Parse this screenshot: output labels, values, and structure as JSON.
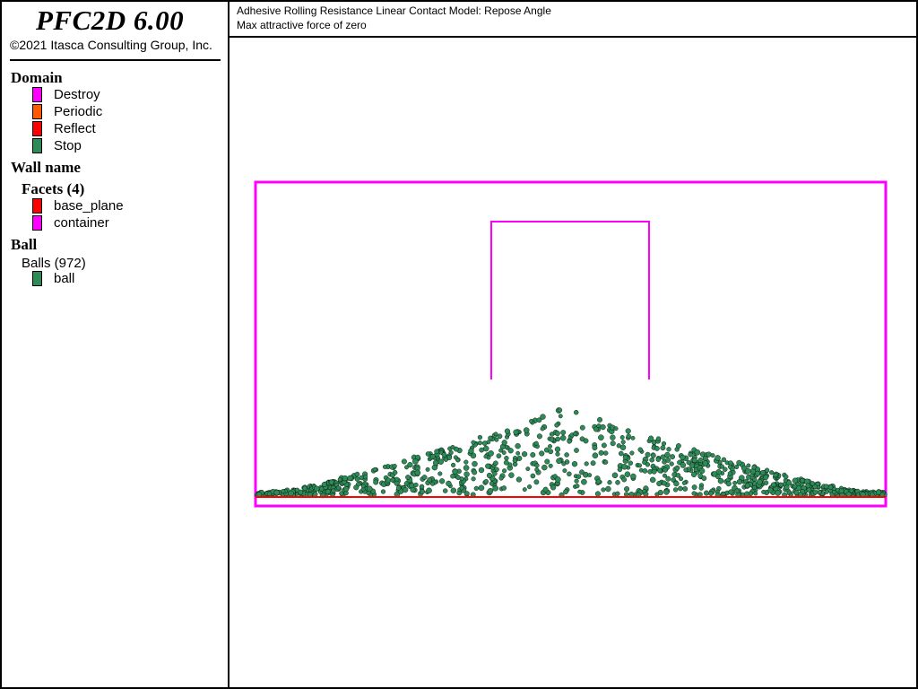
{
  "app": {
    "title": "PFC2D 6.00",
    "copyright": "©2021 Itasca Consulting Group, Inc."
  },
  "legend": {
    "domain": {
      "heading": "Domain",
      "items": [
        {
          "label": "Destroy",
          "color": "#ff00ff"
        },
        {
          "label": "Periodic",
          "color": "#ff5a00"
        },
        {
          "label": "Reflect",
          "color": "#ff0000"
        },
        {
          "label": "Stop",
          "color": "#2e8b57"
        }
      ]
    },
    "wall": {
      "heading": "Wall name",
      "facets_heading": "Facets (4)",
      "items": [
        {
          "label": "base_plane",
          "color": "#ff0000"
        },
        {
          "label": "container",
          "color": "#ff00ff"
        }
      ]
    },
    "ball": {
      "heading": "Ball",
      "balls_heading": "Balls (972)",
      "items": [
        {
          "label": "ball",
          "color": "#2e8b57"
        }
      ]
    }
  },
  "plot": {
    "title_line1": "Adhesive Rolling Resistance Linear Contact Model: Repose Angle",
    "title_line2": "Max attractive force of zero",
    "colors": {
      "container": "#ff00ff",
      "base_plane": "#ff0000",
      "ball": "#2e8b57",
      "ball_edge": "#000000"
    },
    "ball_count": 972
  }
}
